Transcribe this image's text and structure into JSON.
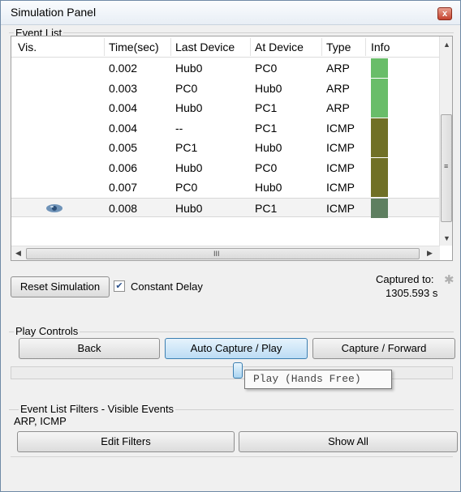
{
  "window": {
    "title": "Simulation Panel",
    "close_glyph": "x"
  },
  "event_list": {
    "label": "Event List",
    "columns": [
      "Vis.",
      "Time(sec)",
      "Last Device",
      "At Device",
      "Type",
      "Info"
    ],
    "rows": [
      {
        "time": "0.002",
        "last": "Hub0",
        "at": "PC0",
        "type": "ARP",
        "color": "#69bd69"
      },
      {
        "time": "0.003",
        "last": "PC0",
        "at": "Hub0",
        "type": "ARP",
        "color": "#69bd69"
      },
      {
        "time": "0.004",
        "last": "Hub0",
        "at": "PC1",
        "type": "ARP",
        "color": "#69bd69"
      },
      {
        "time": "0.004",
        "last": "--",
        "at": "PC1",
        "type": "ICMP",
        "color": "#707026"
      },
      {
        "time": "0.005",
        "last": "PC1",
        "at": "Hub0",
        "type": "ICMP",
        "color": "#707026"
      },
      {
        "time": "0.006",
        "last": "Hub0",
        "at": "PC0",
        "type": "ICMP",
        "color": "#707026"
      },
      {
        "time": "0.007",
        "last": "PC0",
        "at": "Hub0",
        "type": "ICMP",
        "color": "#707026"
      },
      {
        "time": "0.008",
        "last": "Hub0",
        "at": "PC1",
        "type": "ICMP",
        "color": "#5e7f60",
        "selected": true
      }
    ],
    "scroll_mid_glyph": "III"
  },
  "controls": {
    "reset_label": "Reset Simulation",
    "constant_delay_label": "Constant Delay",
    "constant_delay_checked": true,
    "captured_label": "Captured to:",
    "captured_value": "1305.593 s"
  },
  "play_controls": {
    "label": "Play Controls",
    "back_label": "Back",
    "auto_label": "Auto Capture / Play",
    "forward_label": "Capture / Forward",
    "tooltip": "Play (Hands Free)"
  },
  "filters": {
    "label": "Event List Filters - Visible Events",
    "value": "ARP, ICMP",
    "edit_label": "Edit Filters",
    "show_all_label": "Show All"
  },
  "colors": {
    "accent": "#3c7fb1",
    "arp": "#69bd69",
    "icmp": "#707026"
  }
}
